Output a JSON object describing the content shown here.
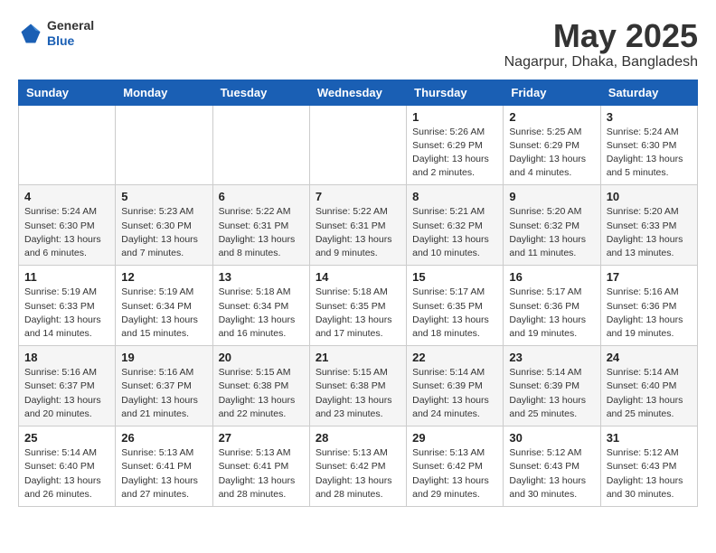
{
  "header": {
    "logo_line1": "General",
    "logo_line2": "Blue",
    "month": "May 2025",
    "location": "Nagarpur, Dhaka, Bangladesh"
  },
  "weekdays": [
    "Sunday",
    "Monday",
    "Tuesday",
    "Wednesday",
    "Thursday",
    "Friday",
    "Saturday"
  ],
  "weeks": [
    [
      {
        "day": "",
        "info": ""
      },
      {
        "day": "",
        "info": ""
      },
      {
        "day": "",
        "info": ""
      },
      {
        "day": "",
        "info": ""
      },
      {
        "day": "1",
        "info": "Sunrise: 5:26 AM\nSunset: 6:29 PM\nDaylight: 13 hours\nand 2 minutes."
      },
      {
        "day": "2",
        "info": "Sunrise: 5:25 AM\nSunset: 6:29 PM\nDaylight: 13 hours\nand 4 minutes."
      },
      {
        "day": "3",
        "info": "Sunrise: 5:24 AM\nSunset: 6:30 PM\nDaylight: 13 hours\nand 5 minutes."
      }
    ],
    [
      {
        "day": "4",
        "info": "Sunrise: 5:24 AM\nSunset: 6:30 PM\nDaylight: 13 hours\nand 6 minutes."
      },
      {
        "day": "5",
        "info": "Sunrise: 5:23 AM\nSunset: 6:30 PM\nDaylight: 13 hours\nand 7 minutes."
      },
      {
        "day": "6",
        "info": "Sunrise: 5:22 AM\nSunset: 6:31 PM\nDaylight: 13 hours\nand 8 minutes."
      },
      {
        "day": "7",
        "info": "Sunrise: 5:22 AM\nSunset: 6:31 PM\nDaylight: 13 hours\nand 9 minutes."
      },
      {
        "day": "8",
        "info": "Sunrise: 5:21 AM\nSunset: 6:32 PM\nDaylight: 13 hours\nand 10 minutes."
      },
      {
        "day": "9",
        "info": "Sunrise: 5:20 AM\nSunset: 6:32 PM\nDaylight: 13 hours\nand 11 minutes."
      },
      {
        "day": "10",
        "info": "Sunrise: 5:20 AM\nSunset: 6:33 PM\nDaylight: 13 hours\nand 13 minutes."
      }
    ],
    [
      {
        "day": "11",
        "info": "Sunrise: 5:19 AM\nSunset: 6:33 PM\nDaylight: 13 hours\nand 14 minutes."
      },
      {
        "day": "12",
        "info": "Sunrise: 5:19 AM\nSunset: 6:34 PM\nDaylight: 13 hours\nand 15 minutes."
      },
      {
        "day": "13",
        "info": "Sunrise: 5:18 AM\nSunset: 6:34 PM\nDaylight: 13 hours\nand 16 minutes."
      },
      {
        "day": "14",
        "info": "Sunrise: 5:18 AM\nSunset: 6:35 PM\nDaylight: 13 hours\nand 17 minutes."
      },
      {
        "day": "15",
        "info": "Sunrise: 5:17 AM\nSunset: 6:35 PM\nDaylight: 13 hours\nand 18 minutes."
      },
      {
        "day": "16",
        "info": "Sunrise: 5:17 AM\nSunset: 6:36 PM\nDaylight: 13 hours\nand 19 minutes."
      },
      {
        "day": "17",
        "info": "Sunrise: 5:16 AM\nSunset: 6:36 PM\nDaylight: 13 hours\nand 19 minutes."
      }
    ],
    [
      {
        "day": "18",
        "info": "Sunrise: 5:16 AM\nSunset: 6:37 PM\nDaylight: 13 hours\nand 20 minutes."
      },
      {
        "day": "19",
        "info": "Sunrise: 5:16 AM\nSunset: 6:37 PM\nDaylight: 13 hours\nand 21 minutes."
      },
      {
        "day": "20",
        "info": "Sunrise: 5:15 AM\nSunset: 6:38 PM\nDaylight: 13 hours\nand 22 minutes."
      },
      {
        "day": "21",
        "info": "Sunrise: 5:15 AM\nSunset: 6:38 PM\nDaylight: 13 hours\nand 23 minutes."
      },
      {
        "day": "22",
        "info": "Sunrise: 5:14 AM\nSunset: 6:39 PM\nDaylight: 13 hours\nand 24 minutes."
      },
      {
        "day": "23",
        "info": "Sunrise: 5:14 AM\nSunset: 6:39 PM\nDaylight: 13 hours\nand 25 minutes."
      },
      {
        "day": "24",
        "info": "Sunrise: 5:14 AM\nSunset: 6:40 PM\nDaylight: 13 hours\nand 25 minutes."
      }
    ],
    [
      {
        "day": "25",
        "info": "Sunrise: 5:14 AM\nSunset: 6:40 PM\nDaylight: 13 hours\nand 26 minutes."
      },
      {
        "day": "26",
        "info": "Sunrise: 5:13 AM\nSunset: 6:41 PM\nDaylight: 13 hours\nand 27 minutes."
      },
      {
        "day": "27",
        "info": "Sunrise: 5:13 AM\nSunset: 6:41 PM\nDaylight: 13 hours\nand 28 minutes."
      },
      {
        "day": "28",
        "info": "Sunrise: 5:13 AM\nSunset: 6:42 PM\nDaylight: 13 hours\nand 28 minutes."
      },
      {
        "day": "29",
        "info": "Sunrise: 5:13 AM\nSunset: 6:42 PM\nDaylight: 13 hours\nand 29 minutes."
      },
      {
        "day": "30",
        "info": "Sunrise: 5:12 AM\nSunset: 6:43 PM\nDaylight: 13 hours\nand 30 minutes."
      },
      {
        "day": "31",
        "info": "Sunrise: 5:12 AM\nSunset: 6:43 PM\nDaylight: 13 hours\nand 30 minutes."
      }
    ]
  ]
}
